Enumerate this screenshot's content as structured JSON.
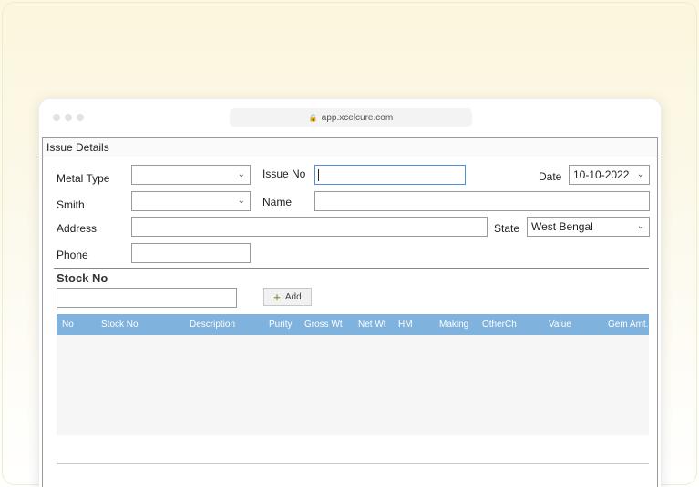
{
  "browser": {
    "url": "app.xcelcure.com"
  },
  "form": {
    "title": "Issue Details",
    "metal_type": {
      "label": "Metal Type",
      "value": ""
    },
    "issue_no": {
      "label": "Issue  No",
      "value": ""
    },
    "date": {
      "label": "Date",
      "value": "10-10-2022"
    },
    "smith": {
      "label": "Smith",
      "value": ""
    },
    "name": {
      "label": "Name",
      "value": ""
    },
    "address": {
      "label": "Address",
      "value": ""
    },
    "state": {
      "label": "State",
      "value": "West Bengal"
    },
    "phone": {
      "label": "Phone",
      "value": ""
    }
  },
  "stock": {
    "title": "Stock No",
    "input_value": "",
    "add_label": "Add"
  },
  "grid": {
    "header_color": "#7fb2dc",
    "columns": [
      "No",
      "Stock No",
      "Description",
      "Purity",
      "Gross Wt",
      "Net Wt",
      "HM",
      "Making",
      "OtherCh",
      "Value",
      "Gem Amt."
    ]
  }
}
